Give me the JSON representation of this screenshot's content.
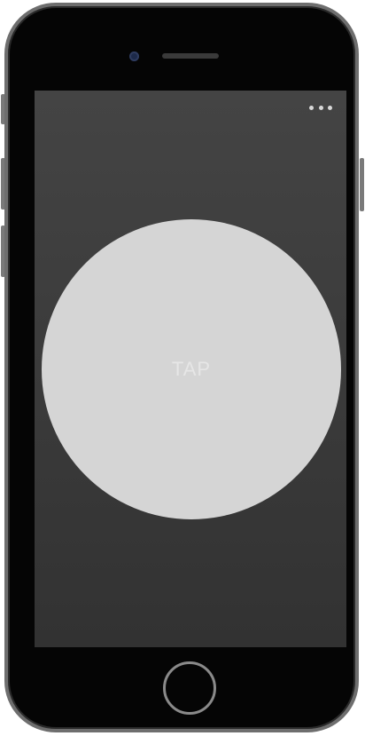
{
  "device": {
    "frame_color": "#050505",
    "bezel_color": "#6e6e6e"
  },
  "screen": {
    "background_top": "#444444",
    "background_bottom": "#323232",
    "menu_icon": "more-horizontal-icon",
    "tap_button": {
      "label": "TAP",
      "color": "#d5d5d5"
    }
  }
}
